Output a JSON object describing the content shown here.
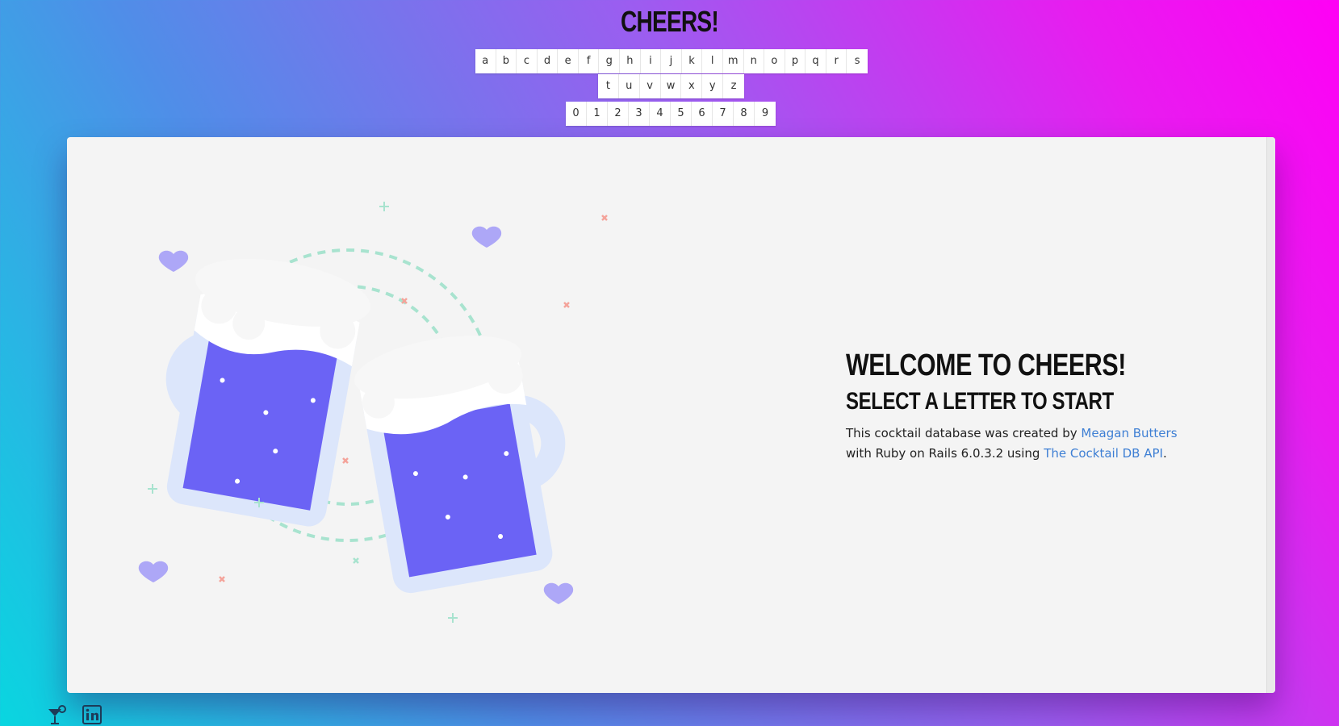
{
  "site": {
    "title": "CHEERS!"
  },
  "letters": {
    "row1": [
      "a",
      "b",
      "c",
      "d",
      "e",
      "f",
      "g",
      "h",
      "i",
      "j",
      "k",
      "l",
      "m",
      "n",
      "o",
      "p",
      "q",
      "r",
      "s"
    ],
    "row2": [
      "t",
      "u",
      "v",
      "w",
      "x",
      "y",
      "z"
    ],
    "row3": [
      "0",
      "1",
      "2",
      "3",
      "4",
      "5",
      "6",
      "7",
      "8",
      "9"
    ]
  },
  "welcome": {
    "heading": "WELCOME TO CHEERS!",
    "subheading": "SELECT A LETTER TO START",
    "text_1": "This cocktail database was created by ",
    "author_link": "Meagan Butters",
    "text_2": "with Ruby on Rails 6.0.3.2 using ",
    "api_link": "The Cocktail DB API",
    "text_3": "."
  },
  "footer": {
    "icons": [
      "cocktail-icon",
      "linkedin-icon"
    ]
  },
  "colors": {
    "accent_link": "#3e7fd4",
    "beer": "#6b63f5",
    "mug": "#dce6fb",
    "heart": "#ada7f7"
  }
}
